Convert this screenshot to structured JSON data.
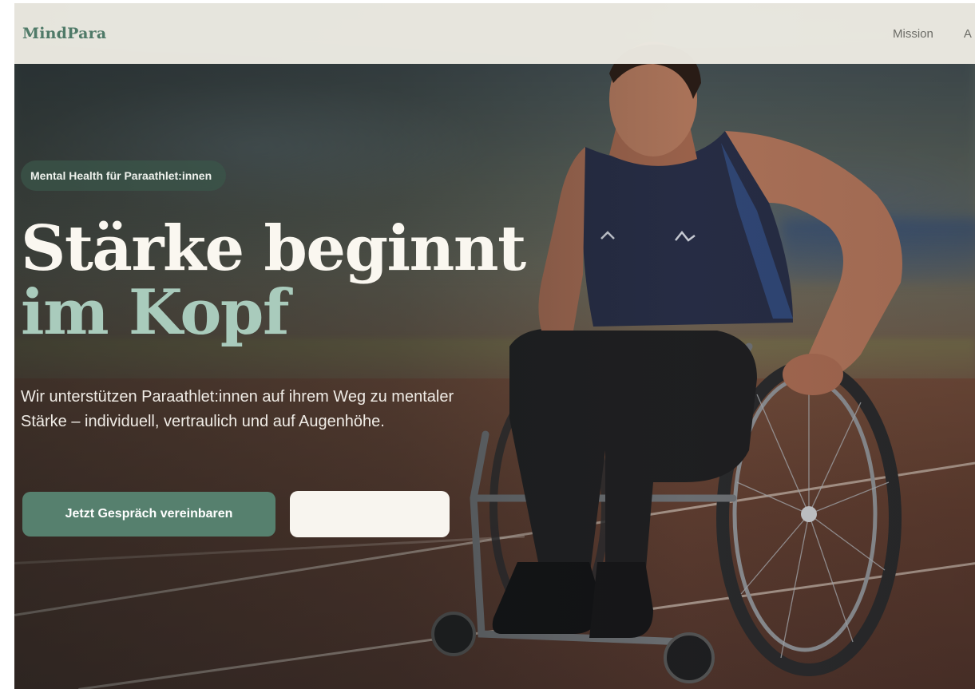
{
  "nav": {
    "brand": "MindPara",
    "links": [
      {
        "label": "Mission"
      },
      {
        "label": "A"
      }
    ]
  },
  "hero": {
    "badge": "Mental Health für Paraathlet:innen",
    "headline_part1": "Stärke beginnt ",
    "headline_accent": "im Kopf",
    "subcopy": "Wir unterstützen Paraathlet:innen auf ihrem Weg zu mentaler Stärke – individuell, vertraulich und auf Augenhöhe.",
    "primary_cta": "Jetzt Gespräch vereinbaren",
    "secondary_cta": ""
  },
  "colors": {
    "brand": "#4f7a68",
    "accent": "#a9cbbc",
    "primary_button": "#56806e",
    "secondary_button": "#f8f5ef",
    "navbar_bg": "#eceae2"
  }
}
